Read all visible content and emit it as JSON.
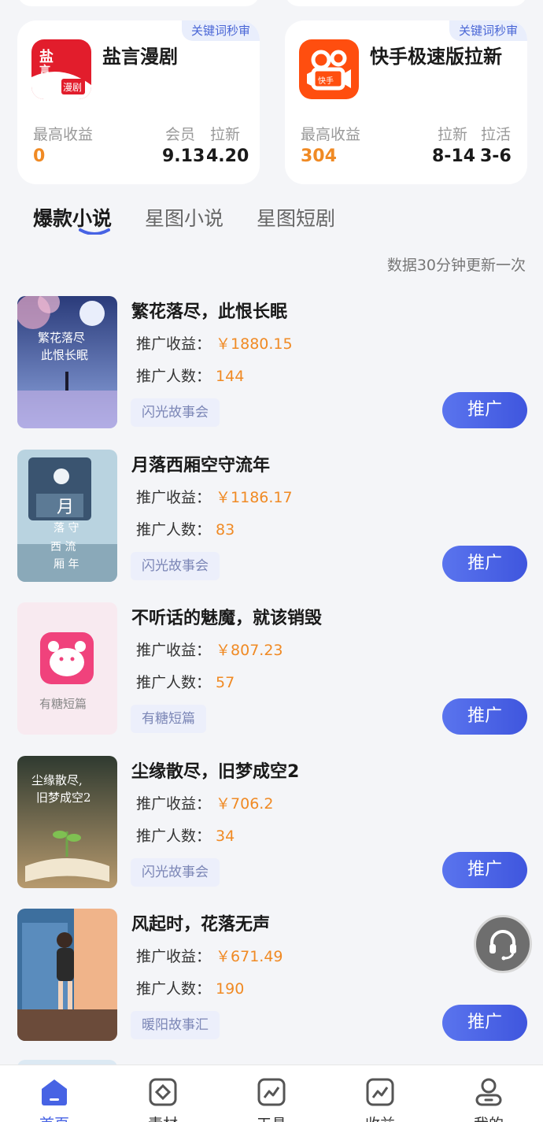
{
  "apps": [
    {
      "name": "盐言漫剧",
      "badge": "关键词秒审",
      "icon_name": "yanyan-manju-app-icon",
      "stats": [
        {
          "label": "最高收益",
          "value": "0",
          "accent": true
        },
        {
          "label": "会员",
          "value": "9.13"
        },
        {
          "label": "拉新",
          "value": "4.20"
        }
      ]
    },
    {
      "name": "快手极速版拉新",
      "badge": "关键词秒审",
      "icon_name": "kuaishou-lite-app-icon",
      "stats": [
        {
          "label": "最高收益",
          "value": "304",
          "accent": true
        },
        {
          "label": "拉新",
          "value": "8-14"
        },
        {
          "label": "拉活",
          "value": "3-6"
        }
      ]
    }
  ],
  "tabs": [
    "爆款小说",
    "星图小说",
    "星图短剧"
  ],
  "active_tab": 0,
  "update_note": "数据30分钟更新一次",
  "row_labels": {
    "income": "推广收益：",
    "people": "推广人数："
  },
  "books": [
    {
      "title": "繁花落尽，此恨长眠",
      "income": "￥1880.15",
      "people": "144",
      "tag": "闪光故事会",
      "button": "推广",
      "cover_text": "繁花落尽此恨长眠"
    },
    {
      "title": "月落西厢空守流年",
      "income": "￥1186.17",
      "people": "83",
      "tag": "闪光故事会",
      "button": "推广",
      "cover_text": "月落西厢空守流年"
    },
    {
      "title": "不听话的魅魔，就该销毁",
      "income": "￥807.23",
      "people": "57",
      "tag": "有糖短篇",
      "button": "推广",
      "cover_text": "有糖短篇"
    },
    {
      "title": "尘缘散尽，旧梦成空2",
      "income": "￥706.2",
      "people": "34",
      "tag": "闪光故事会",
      "button": "推广",
      "cover_text": "尘缘散尽，旧梦成空2"
    },
    {
      "title": "风起时，花落无声",
      "income": "￥671.49",
      "people": "190",
      "tag": "暖阳故事汇",
      "button": "推广",
      "cover_text": ""
    }
  ],
  "tabbar": [
    {
      "label": "首页",
      "icon": "home-icon",
      "active": true
    },
    {
      "label": "素材",
      "icon": "material-icon",
      "active": false
    },
    {
      "label": "工具",
      "icon": "chart-icon",
      "active": false
    },
    {
      "label": "收益",
      "icon": "chart-icon",
      "active": false
    },
    {
      "label": "我的",
      "icon": "user-icon",
      "active": false
    }
  ],
  "colors": {
    "accent": "#4763e4",
    "orange": "#f08a24",
    "button": "#4a63e6"
  }
}
